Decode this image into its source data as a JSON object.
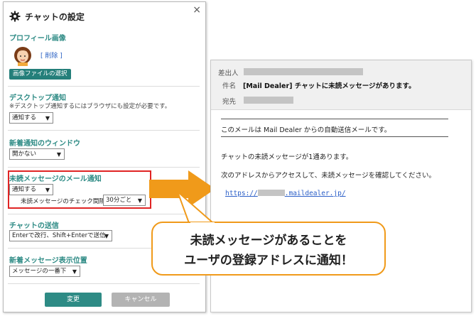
{
  "panel": {
    "title": "チャットの設定",
    "close_label": "×",
    "profile": {
      "heading": "プロフィール画像",
      "delete_link": "[ 削除 ]",
      "file_button": "画像ファイルの選択"
    },
    "desktop_notify": {
      "heading": "デスクトップ通知",
      "note": "※デスクトップ通知するにはブラウザにも設定が必要です。",
      "select_value": "通知する"
    },
    "new_notify_window": {
      "heading": "新着通知のウィンドウ",
      "select_value": "開かない"
    },
    "unread_mail_notify": {
      "heading": "未読メッセージのメール通知",
      "select_value": "通知する",
      "check_label": "未読メッセージのチェック間隔",
      "interval_value": "30分ごと"
    },
    "chat_send": {
      "heading": "チャットの送信",
      "select_value": "Enterで改行、Shift+Enterで送信"
    },
    "new_message_position": {
      "heading": "新着メッセージ表示位置",
      "select_value": "メッセージの一番下"
    },
    "ok_button": "変更",
    "cancel_button": "キャンセル",
    "select_arrow": "▼"
  },
  "mail": {
    "from_label": "差出人",
    "subject_label": "件名",
    "subject_value": "[Mail Dealer] チャットに未読メッセージがあります。",
    "to_label": "宛先",
    "body_line1": "このメールは Mail Dealer からの自動送信メールです。",
    "body_line2": "チャットの未読メッセージが1通あります。",
    "body_line3": "次のアドレスからアクセスして、未読メッセージを確認してください。",
    "url_prefix": "https://",
    "url_suffix": ".maildealer.jp/"
  },
  "callout": {
    "line1": "未読メッセージがあることを",
    "line2": "ユーザの登録アドレスに通知！"
  },
  "colors": {
    "accent_teal": "#2e8b85",
    "highlight_red": "#e02424",
    "arrow_orange": "#f09a1a",
    "link_blue": "#2b5fc8"
  }
}
